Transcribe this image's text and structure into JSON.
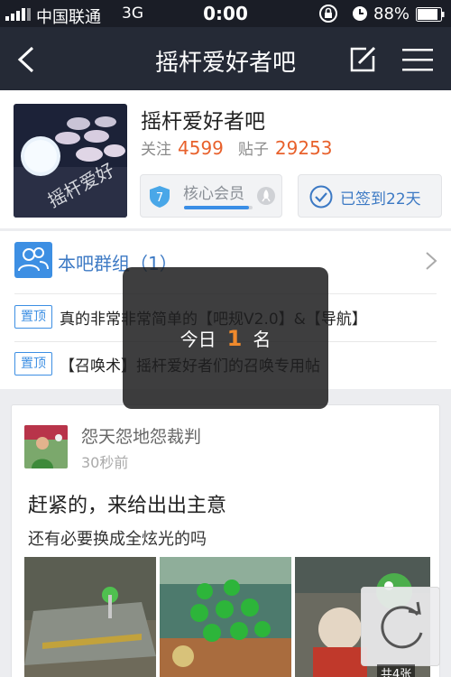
{
  "status_bar": {
    "carrier": "中国联通",
    "network": "3G",
    "time": "0:00",
    "battery": "88%",
    "battery_level": 0.88
  },
  "nav": {
    "title": "摇杆爱好者吧",
    "back_icon": "chevron-left-icon",
    "edit_icon": "edit-icon",
    "menu_icon": "menu-icon"
  },
  "forum": {
    "name": "摇杆爱好者吧",
    "follow_label": "关注",
    "follow_count": "4599",
    "posts_label": "贴子",
    "posts_count": "29253",
    "level": "7",
    "member_label": "核心会员",
    "member_progress": 0.95,
    "signin_label": "已签到22天"
  },
  "group": {
    "label": "本吧群组（1）"
  },
  "pinned": [
    {
      "tag": "置顶",
      "text": "真的非常非常简单的【吧规V2.0】&【导航】"
    },
    {
      "tag": "置顶",
      "text": "【召唤术】摇杆爱好者们的召唤专用帖"
    }
  ],
  "post": {
    "user": "怨天怨地怨裁判",
    "time": "30秒前",
    "title": "赶紧的，来给出出主意",
    "body": "还有必要换成全炫光的吗",
    "image_count": "共4张"
  },
  "toast": {
    "prefix": "今日",
    "rank": "1",
    "suffix": "名"
  },
  "colors": {
    "accent": "#3d8fe3",
    "highlight": "#e8612c",
    "nav_bg": "#252a36"
  }
}
